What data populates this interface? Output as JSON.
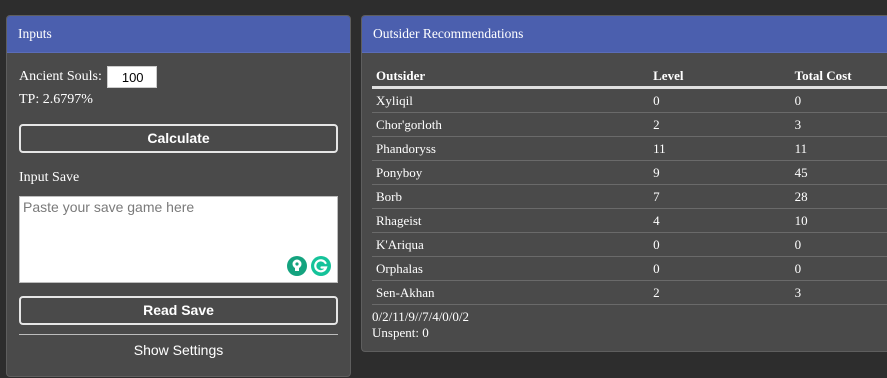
{
  "inputs": {
    "header": "Inputs",
    "ancient_souls_label": "Ancient Souls:",
    "ancient_souls_value": "100",
    "tp_text": "TP: 2.6797%",
    "calculate_label": "Calculate",
    "input_save_label": "Input Save",
    "save_placeholder": "Paste your save game here",
    "read_save_label": "Read Save",
    "show_settings_label": "Show Settings"
  },
  "outsiders": {
    "header": "Outsider Recommendations",
    "columns": [
      "Outsider",
      "Level",
      "Total Cost"
    ],
    "rows": [
      {
        "name": "Xyliqil",
        "level": "0",
        "cost": "0"
      },
      {
        "name": "Chor'gorloth",
        "level": "2",
        "cost": "3"
      },
      {
        "name": "Phandoryss",
        "level": "11",
        "cost": "11"
      },
      {
        "name": "Ponyboy",
        "level": "9",
        "cost": "45"
      },
      {
        "name": "Borb",
        "level": "7",
        "cost": "28"
      },
      {
        "name": "Rhageist",
        "level": "4",
        "cost": "10"
      },
      {
        "name": "K'Ariqua",
        "level": "0",
        "cost": "0"
      },
      {
        "name": "Orphalas",
        "level": "0",
        "cost": "0"
      },
      {
        "name": "Sen-Akhan",
        "level": "2",
        "cost": "3"
      }
    ],
    "build_string": "0/2/11/9//7/4/0/0/2",
    "unspent": "Unspent: 0"
  },
  "colors": {
    "header_bg": "#4b5fae",
    "panel_bg": "#4a4a4a",
    "page_bg": "#2d2d2d",
    "grammarly_green": "#15c39a"
  },
  "icons": [
    "grammarly-bulb-icon",
    "grammarly-g-icon"
  ]
}
